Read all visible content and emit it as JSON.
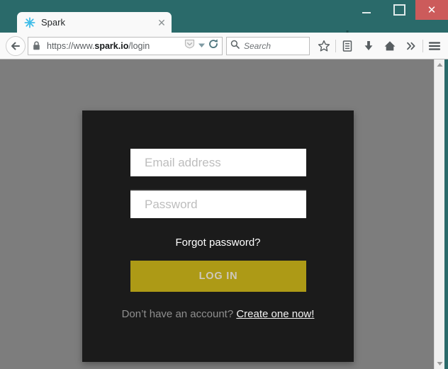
{
  "window": {
    "minimize_label": "–",
    "maximize_label": "□",
    "close_label": "✕",
    "titlebar_color": "#2a6a6a",
    "close_color": "#cc5b5b"
  },
  "tabs": [
    {
      "title": "Spark",
      "favicon": "spark-asterisk-icon",
      "close_label": "✕",
      "active": true
    }
  ],
  "newtab": {
    "label": "+",
    "icon": "plus-icon"
  },
  "toolbar": {
    "back_icon": "back-arrow-icon",
    "lock_icon": "padlock-icon",
    "url_prefix": "https://www.",
    "url_domain": "spark.io",
    "url_suffix": "/login",
    "url_full": "https://www.spark.io/login",
    "shield_icon": "reader-shield-icon",
    "dropdown_icon": "chevron-down-icon",
    "reload_icon": "reload-icon",
    "search_placeholder": "Search",
    "search_value": "",
    "search_icon": "magnifier-icon",
    "bookmark_icon": "star-icon",
    "reading_list_icon": "reading-list-icon",
    "downloads_icon": "download-arrow-icon",
    "home_icon": "home-icon",
    "overflow_icon": "double-chevron-right-icon",
    "menu_icon": "hamburger-menu-icon"
  },
  "page": {
    "background_color": "#7d7d7d",
    "card_color": "#1b1b1b",
    "accent_color": "#ad9a16",
    "email": {
      "placeholder": "Email address",
      "value": ""
    },
    "password": {
      "placeholder": "Password",
      "value": ""
    },
    "forgot_password_label": "Forgot password?",
    "login_button_label": "LOG IN",
    "signup_prompt": "Don’t have an account? ",
    "signup_link_label": "Create one now!"
  },
  "scrollbar": {
    "up_arrow": "▲",
    "down_arrow": "▼"
  }
}
